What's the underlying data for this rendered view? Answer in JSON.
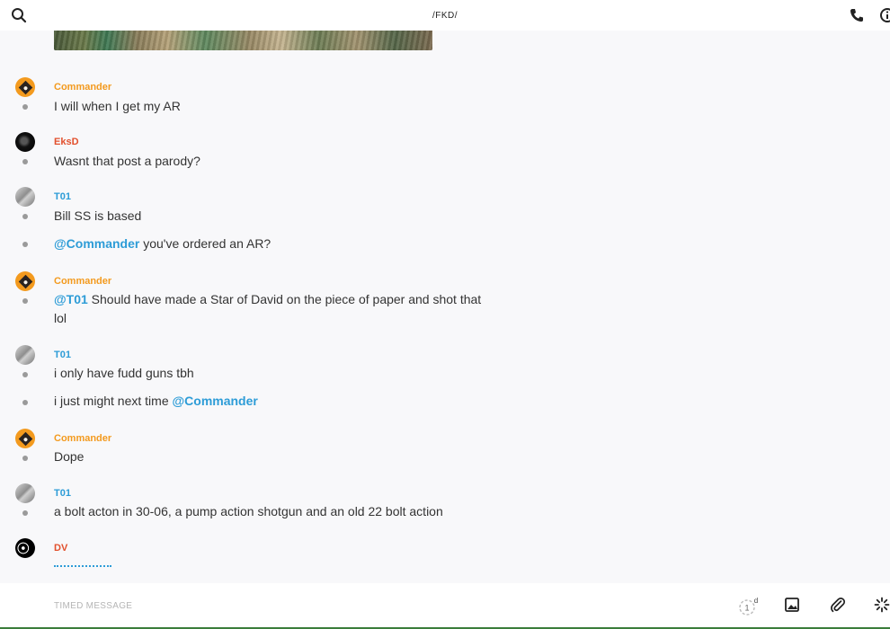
{
  "header": {
    "title": "/FKD/",
    "icons": {
      "search": "search-icon",
      "call": "phone-icon",
      "info": "info-icon"
    }
  },
  "colors": {
    "commander": "#f39a1e",
    "eksd": "#e2502d",
    "t01": "#2d9cd7",
    "dv": "#e2502d",
    "mention": "#2d9cd7"
  },
  "messages": [
    {
      "sender": "Commander",
      "lines": [
        {
          "text": "I will when I get my AR"
        }
      ]
    },
    {
      "sender": "EksD",
      "lines": [
        {
          "text": "Wasnt that post a parody?"
        }
      ]
    },
    {
      "sender": "T01",
      "lines": [
        {
          "text": "Bill SS is based"
        },
        {
          "mention": "@Commander",
          "text": " you've ordered an AR?"
        }
      ]
    },
    {
      "sender": "Commander",
      "lines": [
        {
          "mention": "@T01",
          "text": " Should have made a Star of David on the piece of paper and shot that lol"
        }
      ]
    },
    {
      "sender": "T01",
      "lines": [
        {
          "text": "i only have fudd guns tbh"
        },
        {
          "text": "i just might next time ",
          "mention_after": "@Commander"
        }
      ]
    },
    {
      "sender": "Commander",
      "lines": [
        {
          "text": "Dope"
        }
      ]
    },
    {
      "sender": "T01",
      "lines": [
        {
          "text": "a bolt acton in 30-06, a pump action shotgun and an old 22 bolt action"
        }
      ]
    },
    {
      "sender": "DV",
      "lines": []
    }
  ],
  "composer": {
    "placeholder": "TIMED MESSAGE",
    "timer_value": "1",
    "timer_unit": "d",
    "icons": {
      "timer": "timer-icon",
      "image": "image-icon",
      "attach": "paperclip-icon",
      "more": "ping-icon"
    }
  }
}
